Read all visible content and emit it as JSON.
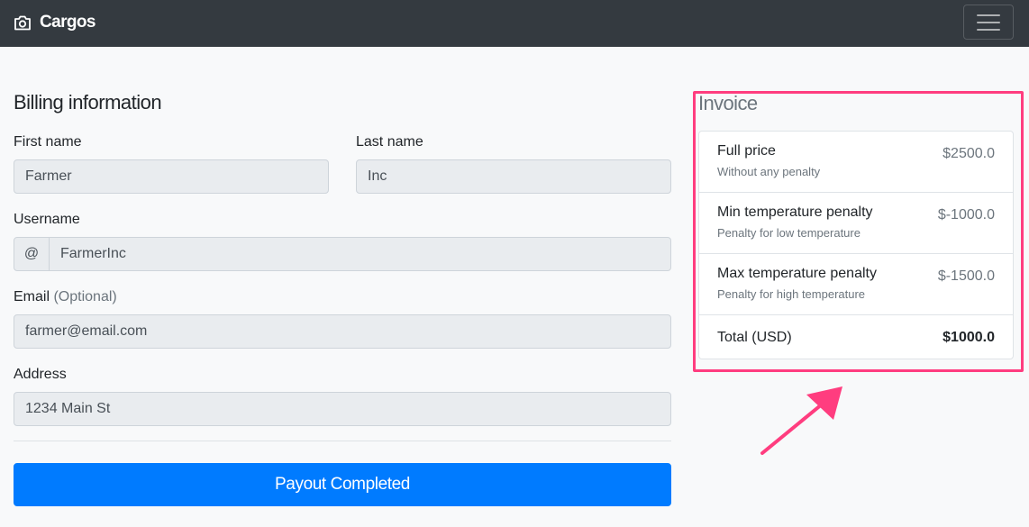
{
  "navbar": {
    "brand": "Cargos",
    "brand_icon": "camera-icon",
    "menu_icon": "hamburger-menu-icon"
  },
  "billing": {
    "heading": "Billing information",
    "first_name_label": "First name",
    "first_name_value": "Farmer",
    "last_name_label": "Last name",
    "last_name_value": "Inc",
    "username_label": "Username",
    "username_prefix": "@",
    "username_value": "FarmerInc",
    "email_label": "Email",
    "email_optional": "(Optional)",
    "email_value": "farmer@email.com",
    "address_label": "Address",
    "address_value": "1234 Main St",
    "submit_label": "Payout Completed"
  },
  "invoice": {
    "heading": "Invoice",
    "items": [
      {
        "title": "Full price",
        "subtitle": "Without any penalty",
        "value": "$2500.0"
      },
      {
        "title": "Min temperature penalty",
        "subtitle": "Penalty for low temperature",
        "value": "$-1000.0"
      },
      {
        "title": "Max temperature penalty",
        "subtitle": "Penalty for high temperature",
        "value": "$-1500.0"
      }
    ],
    "total_label": "Total (USD)",
    "total_value": "$1000.0"
  },
  "colors": {
    "navbar": "#343a40",
    "primary": "#007bff",
    "highlight": "#ff3d7f",
    "background": "#f8f9fa"
  }
}
